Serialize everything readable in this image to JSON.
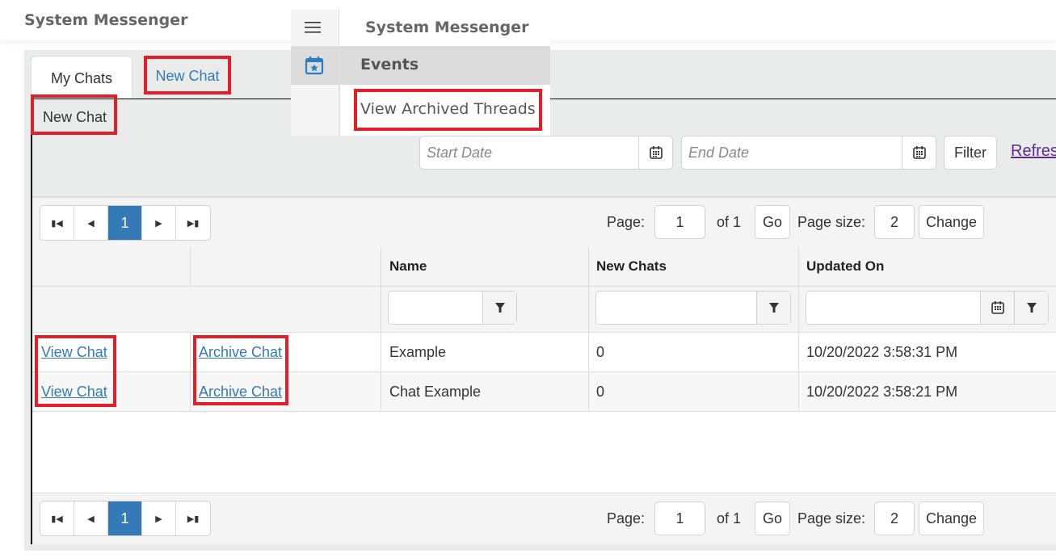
{
  "header": {
    "app_title": "System Messenger"
  },
  "nav_menu": {
    "title": "System Messenger",
    "menu_icon": "hamburger-icon",
    "items": [
      {
        "label": "Events",
        "icon": "calendar-star-icon",
        "active": true
      },
      {
        "label": "View Archived Threads",
        "icon": ""
      }
    ]
  },
  "tabs": [
    {
      "label": "My Chats",
      "active": true
    },
    {
      "label": "New Chat",
      "active": false
    }
  ],
  "panel": {
    "new_chat_label": "New Chat",
    "date_filter": {
      "start_placeholder": "Start Date",
      "end_placeholder": "End Date",
      "start_value": "",
      "end_value": "",
      "filter_label": "Filter",
      "refresh_label": "Refresh"
    }
  },
  "pager": {
    "first_icon": "first-page-icon",
    "prev_icon": "prev-page-icon",
    "current_page": "1",
    "next_icon": "next-page-icon",
    "last_icon": "last-page-icon",
    "page_label": "Page:",
    "page_value": "1",
    "of_label": "of 1",
    "go_label": "Go",
    "page_size_label": "Page size:",
    "page_size_value": "2",
    "change_label": "Change"
  },
  "table": {
    "columns": [
      "",
      "",
      "Name",
      "New Chats",
      "Updated On"
    ],
    "filters": {
      "name": "",
      "new_chats": "",
      "updated_on": ""
    },
    "rows": [
      {
        "view": "View Chat",
        "archive": "Archive Chat",
        "name": "Example",
        "new_chats": "0",
        "updated_on": "10/20/2022 3:58:31 PM"
      },
      {
        "view": "View Chat",
        "archive": "Archive Chat",
        "name": "Chat Example",
        "new_chats": "0",
        "updated_on": "10/20/2022 3:58:21 PM"
      }
    ]
  },
  "colors": {
    "accent": "#337ab7",
    "highlight_box": "#e41e26",
    "visited_link": "#5b2a92"
  }
}
